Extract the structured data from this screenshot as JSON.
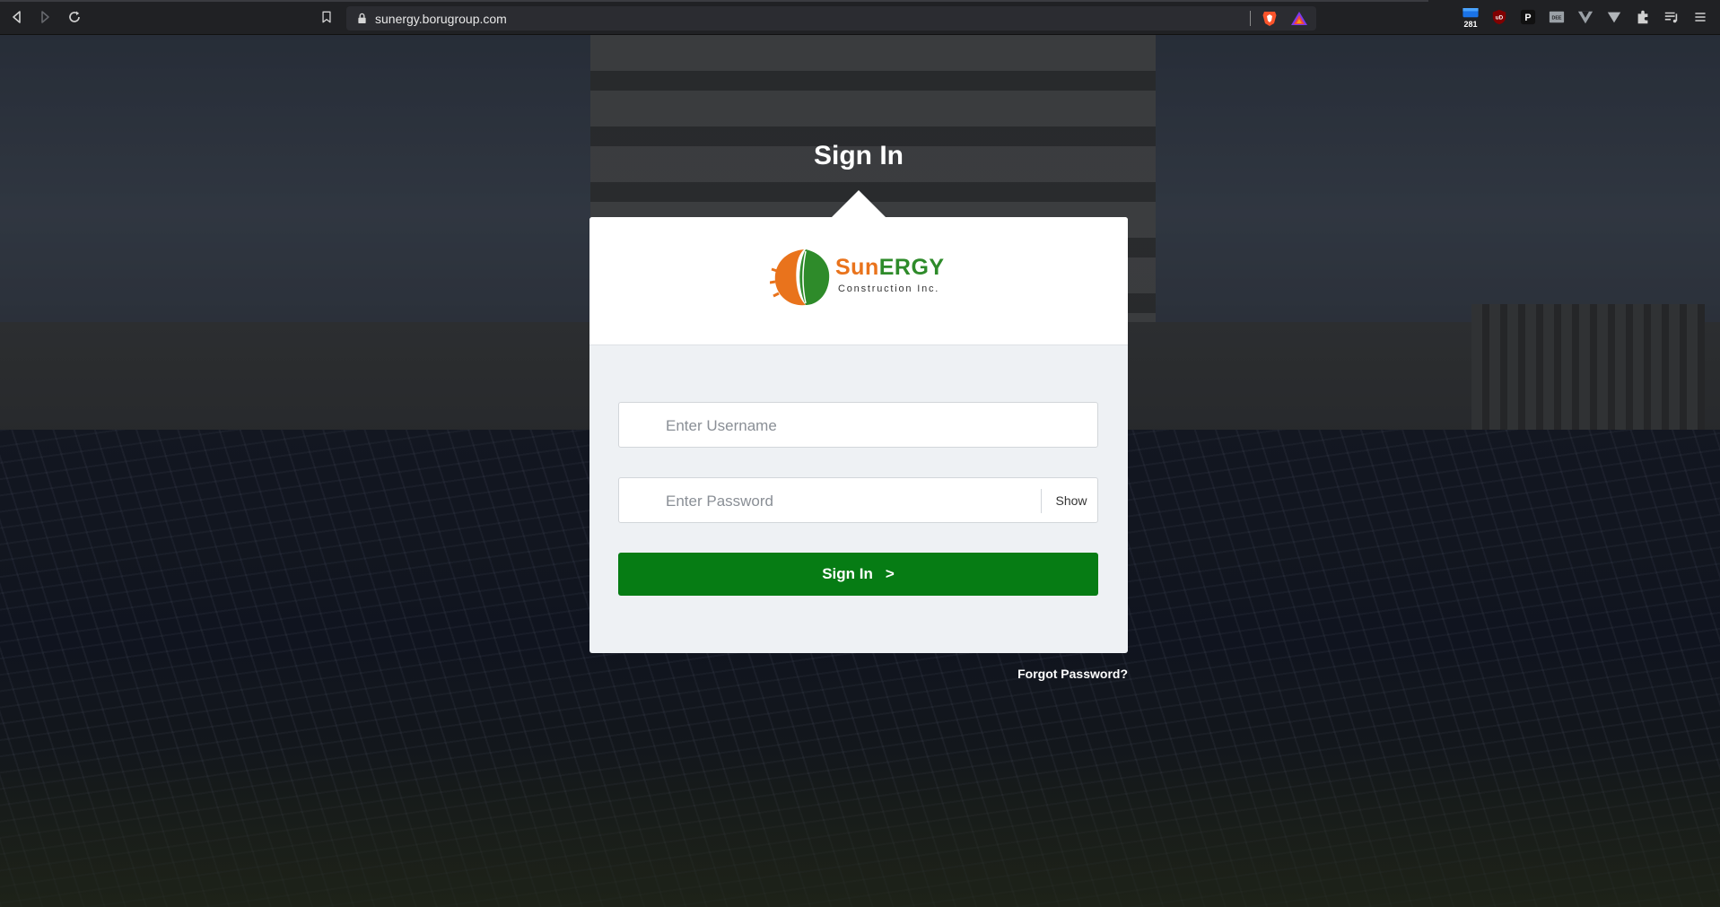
{
  "browser": {
    "url": "sunergy.borugroup.com",
    "extensions": [
      {
        "icon": "calendar-extension-icon",
        "badge": "281",
        "color": "#1a73e8"
      },
      {
        "icon": "ublock-origin-icon",
        "label": "uD",
        "color": "#8b0000"
      },
      {
        "icon": "p-extension-icon",
        "label": "P",
        "color": "#111111"
      },
      {
        "icon": "dee-extension-icon",
        "label": "DEE",
        "color": "#9aa0a6"
      },
      {
        "icon": "vue-devtools-icon",
        "color": "#9aa0a6"
      },
      {
        "icon": "v-extension-icon",
        "color": "#9aa0a6"
      },
      {
        "icon": "puzzle-extensions-icon",
        "color": "#d0d0d0"
      },
      {
        "icon": "playlist-icon",
        "color": "#d0d0d0"
      },
      {
        "icon": "menu-icon",
        "color": "#d0d0d0"
      }
    ]
  },
  "login": {
    "title": "Sign In",
    "logo_word_sun": "Sun",
    "logo_word_ergy": "ERGY",
    "logo_sub": "Construction Inc.",
    "username_placeholder": "Enter Username",
    "password_placeholder": "Enter Password",
    "show_label": "Show",
    "signin_label": "Sign In",
    "signin_arrow": ">",
    "forgot_label": "Forgot Password?"
  },
  "colors": {
    "accent": "#067c14",
    "logo_orange": "#e9731c",
    "logo_green": "#2e8b2a"
  }
}
